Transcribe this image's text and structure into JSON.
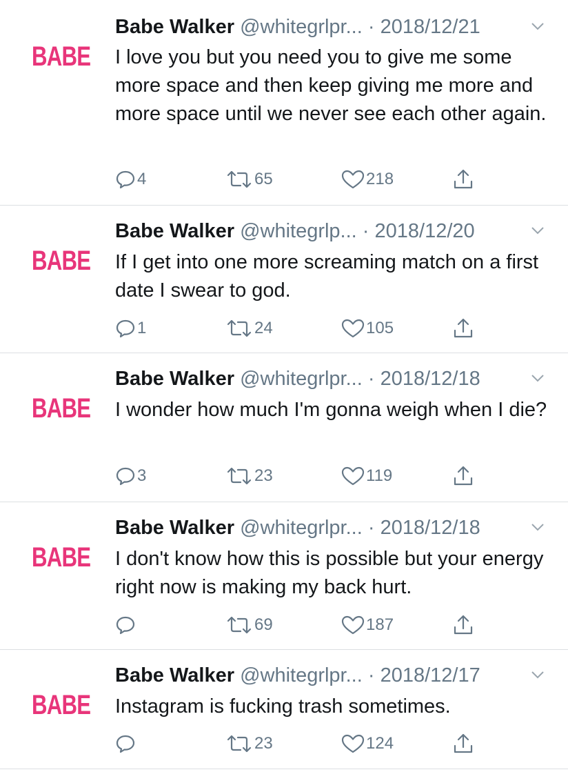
{
  "tweets": [
    {
      "avatar_text": "BABE",
      "name": "Babe Walker",
      "handle": "@whitegrlpr...",
      "separator": "·",
      "date": "2018/12/21",
      "text": "I love you but you need you to give me some more space and then keep giving me more and more space until we never see each other again.",
      "replies": "4",
      "retweets": "65",
      "likes": "218"
    },
    {
      "avatar_text": "BABE",
      "name": "Babe Walker",
      "handle": "@whitegrlp...",
      "separator": "·",
      "date": "2018/12/20",
      "text": "If I get into one more screaming match on a first date I swear to god.",
      "replies": "1",
      "retweets": "24",
      "likes": "105"
    },
    {
      "avatar_text": "BABE",
      "name": "Babe Walker",
      "handle": "@whitegrlpr...",
      "separator": "·",
      "date": "2018/12/18",
      "text": "I wonder how much I'm gonna weigh when I die?",
      "replies": "3",
      "retweets": "23",
      "likes": "119"
    },
    {
      "avatar_text": "BABE",
      "name": "Babe Walker",
      "handle": "@whitegrlpr...",
      "separator": "·",
      "date": "2018/12/18",
      "text": "I don't know how this is possible but your energy right now is making my back hurt.",
      "replies": "",
      "retweets": "69",
      "likes": "187"
    },
    {
      "avatar_text": "BABE",
      "name": "Babe Walker",
      "handle": "@whitegrlpr...",
      "separator": "·",
      "date": "2018/12/17",
      "text": "Instagram is fucking trash sometimes.",
      "replies": "",
      "retweets": "23",
      "likes": "124"
    }
  ],
  "icons": {
    "reply": "reply-icon",
    "retweet": "retweet-icon",
    "like": "heart-icon",
    "share": "share-icon",
    "menu": "chevron-down-icon"
  },
  "colors": {
    "brand_pink": "#e8357a",
    "text": "#14171a",
    "muted": "#657786",
    "divider": "#dcdfe2"
  }
}
